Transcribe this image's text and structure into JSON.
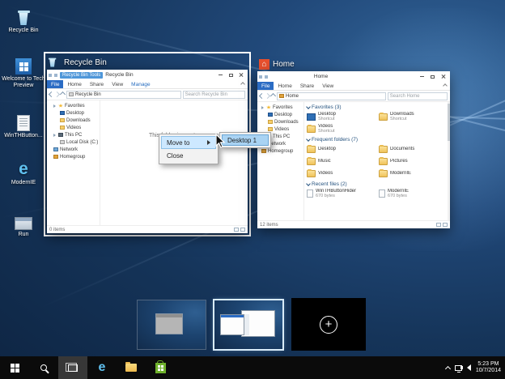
{
  "icons": {
    "ie": "e",
    "add_desktop": "+"
  },
  "desktop_icons": [
    {
      "label": "Recycle Bin"
    },
    {
      "label": "Welcome to Tech Preview"
    },
    {
      "label": "WinTHButton..."
    },
    {
      "label": "ModernIE"
    },
    {
      "label": "Run"
    }
  ],
  "task_view": {
    "recycle": {
      "label": "Recycle Bin",
      "title": "Recycle Bin",
      "tools_tab": "Recycle Bin Tools",
      "tabs": [
        "File",
        "Home",
        "Share",
        "View",
        "Manage"
      ],
      "address": "Recycle Bin",
      "search_placeholder": "Search Recycle Bin",
      "nav": [
        "Favorites",
        "Desktop",
        "Downloads",
        "Videos",
        "This PC",
        "Local Disk (C:)",
        "Network",
        "Homegroup"
      ],
      "empty_text": "This folder is empty.",
      "status": "0 items"
    },
    "home": {
      "label": "Home",
      "title": "Home",
      "tabs": [
        "File",
        "Home",
        "Share",
        "View"
      ],
      "address": "Home",
      "search_placeholder": "Search Home",
      "nav": [
        "Favorites",
        "Desktop",
        "Downloads",
        "Videos",
        "This PC",
        "Network",
        "Homegroup"
      ],
      "sections": [
        {
          "header": "Favorites (3)",
          "tiles": [
            {
              "name": "Desktop",
              "sub": "Shortcut"
            },
            {
              "name": "Downloads",
              "sub": "Shortcut"
            },
            {
              "name": "Videos",
              "sub": "Shortcut"
            }
          ]
        },
        {
          "header": "Frequent folders (7)",
          "tiles": [
            {
              "name": "Desktop"
            },
            {
              "name": "Documents"
            },
            {
              "name": "Music"
            },
            {
              "name": "Pictures"
            },
            {
              "name": "Videos"
            },
            {
              "name": "ModernIE"
            }
          ]
        },
        {
          "header": "Recent files (2)",
          "tiles": [
            {
              "name": "WinTHButtonHider",
              "sub": "670 bytes"
            },
            {
              "name": "ModernIE",
              "sub": "670 bytes"
            }
          ]
        }
      ],
      "status": "12 items"
    }
  },
  "context_menu": {
    "items": [
      {
        "label": "Move to"
      },
      {
        "label": "Close"
      }
    ],
    "submenu": [
      {
        "label": "Desktop 1"
      }
    ]
  },
  "taskbar": {
    "tray": {
      "time": "5:23 PM",
      "date": "10/7/2014"
    }
  }
}
